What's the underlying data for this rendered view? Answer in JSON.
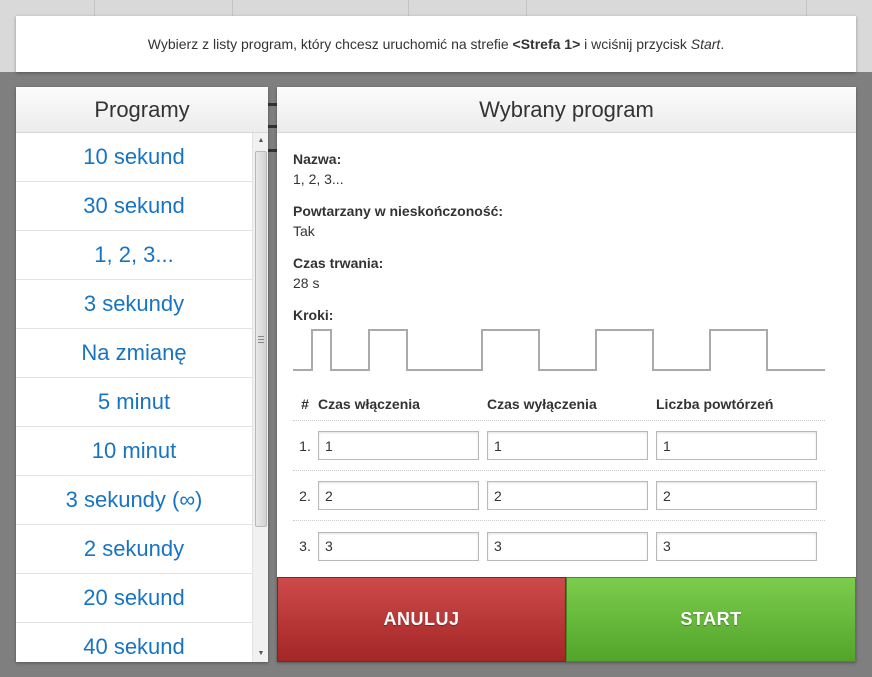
{
  "instruction": {
    "prefix": "Wybierz z listy program, który chcesz uruchomić na strefie ",
    "zone": "<Strefa 1>",
    "middle": " i wciśnij przycisk ",
    "button": "Start",
    "suffix": "."
  },
  "programs": {
    "title": "Programy",
    "items": [
      "10 sekund",
      "30 sekund",
      "1, 2, 3...",
      "3 sekundy",
      "Na zmianę",
      "5 minut",
      "10 minut",
      "3 sekundy (∞)",
      "2 sekundy",
      "20 sekund",
      "40 sekund"
    ],
    "scroll_position": 0
  },
  "selected_program": {
    "title": "Wybrany program",
    "name_label": "Nazwa:",
    "name": "1, 2, 3...",
    "repeat_label": "Powtarzany w nieskończoność:",
    "repeat": "Tak",
    "duration_label": "Czas trwania:",
    "duration": "28 s",
    "steps_label": "Kroki:",
    "table": {
      "headers": [
        "#",
        "Czas włączenia",
        "Czas wyłączenia",
        "Liczba powtórzeń"
      ],
      "rows": [
        {
          "num": "1.",
          "on": "1",
          "off": "1",
          "repeat": "1"
        },
        {
          "num": "2.",
          "on": "2",
          "off": "2",
          "repeat": "2"
        },
        {
          "num": "3.",
          "on": "3",
          "off": "3",
          "repeat": "3"
        }
      ]
    }
  },
  "actions": {
    "cancel_label": "ANULUJ",
    "start_label": "START"
  },
  "colors": {
    "link": "#1874c2",
    "cancel": "#b83535",
    "start": "#62b838"
  }
}
